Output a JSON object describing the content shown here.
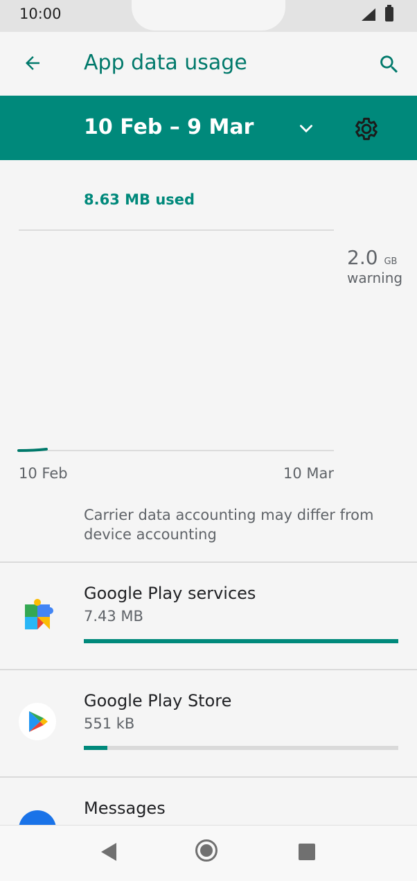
{
  "status_bar": {
    "time": "10:00"
  },
  "toolbar": {
    "title": "App data usage",
    "back_icon": "arrow-back-icon",
    "search_icon": "search-icon"
  },
  "cycle": {
    "range": "10 Feb – 9 Mar",
    "dropdown_icon": "chevron-down-icon",
    "settings_icon": "gear-icon"
  },
  "usage": {
    "used_label": "8.63 MB used",
    "warning_value": "2.0",
    "warning_unit": "GB",
    "warning_label": "warning",
    "x_start": "10 Feb",
    "x_end": "10 Mar",
    "note": "Carrier data accounting may differ from device accounting"
  },
  "apps": [
    {
      "name": "Google Play services",
      "size": "7.43 MB",
      "fraction": 1.0,
      "icon": "google-play-services-icon"
    },
    {
      "name": "Google Play Store",
      "size": "551 kB",
      "fraction": 0.074,
      "icon": "google-play-store-icon"
    },
    {
      "name": "Messages",
      "size": "",
      "fraction": 0,
      "icon": "messages-icon"
    }
  ],
  "colors": {
    "accent": "#00897b",
    "title": "#00796b",
    "track": "#dadada"
  },
  "nav": {
    "back": "nav-back-icon",
    "home": "nav-home-icon",
    "recent": "nav-recent-icon"
  }
}
